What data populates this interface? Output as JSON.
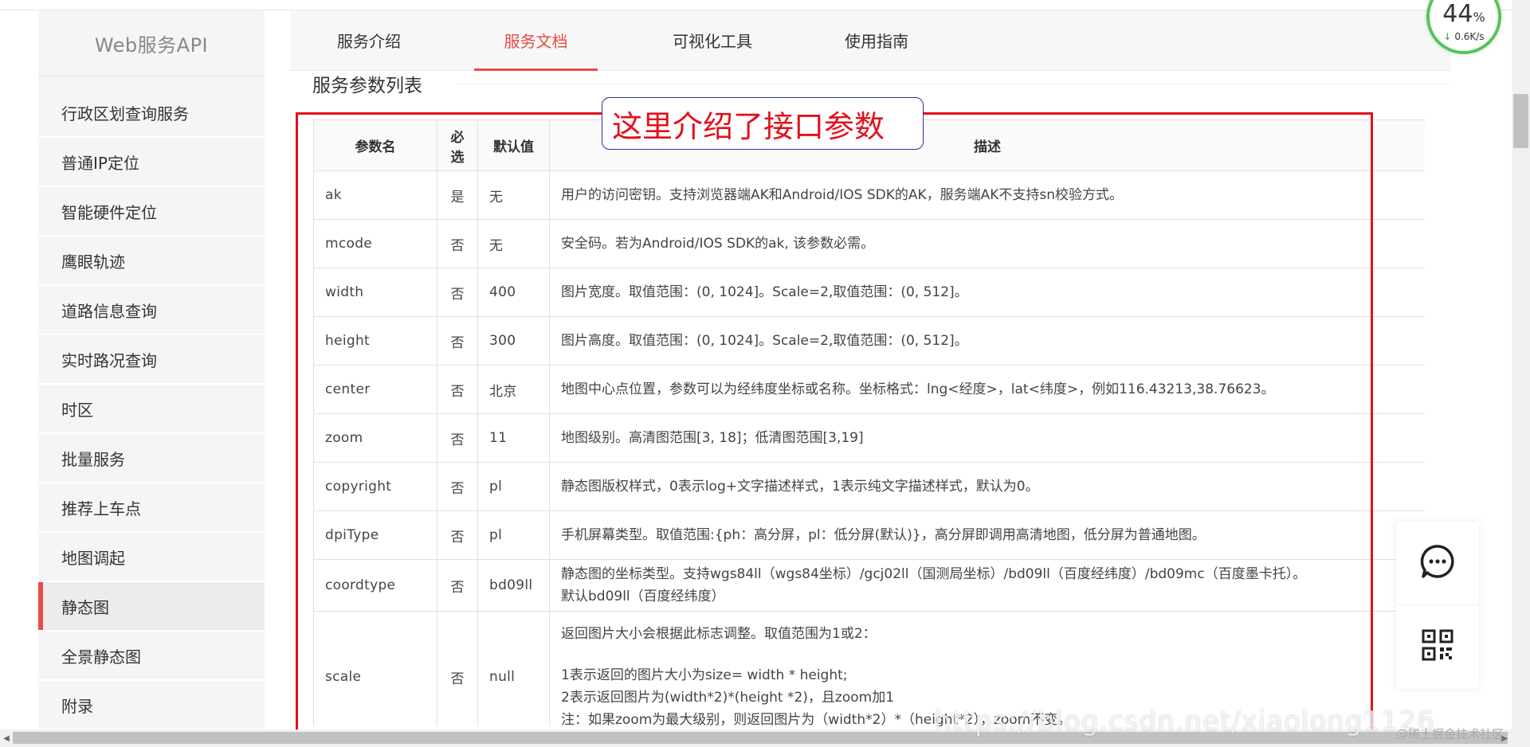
{
  "sidebar": {
    "brand": "Web服务API",
    "items": [
      {
        "label": "行政区划查询服务"
      },
      {
        "label": "普通IP定位"
      },
      {
        "label": "智能硬件定位"
      },
      {
        "label": "鹰眼轨迹"
      },
      {
        "label": "道路信息查询"
      },
      {
        "label": "实时路况查询"
      },
      {
        "label": "时区"
      },
      {
        "label": "批量服务"
      },
      {
        "label": "推荐上车点"
      },
      {
        "label": "地图调起"
      },
      {
        "label": "静态图",
        "active": true
      },
      {
        "label": "全景静态图"
      },
      {
        "label": "附录"
      }
    ]
  },
  "tabs": [
    {
      "label": "服务介绍"
    },
    {
      "label": "服务文档",
      "active": true
    },
    {
      "label": "可视化工具"
    },
    {
      "label": "使用指南"
    }
  ],
  "section_title": "服务参数列表",
  "annotation": "这里介绍了接口参数",
  "table": {
    "headers": {
      "name": "参数名",
      "required": "必选",
      "default": "默认值",
      "desc": "描述"
    },
    "rows": [
      {
        "name": "ak",
        "required": "是",
        "default": "无",
        "desc": [
          "用户的访问密钥。支持浏览器端AK和Android/IOS SDK的AK，服务端AK不支持sn校验方式。"
        ]
      },
      {
        "name": "mcode",
        "required": "否",
        "default": "无",
        "desc": [
          "安全码。若为Android/IOS SDK的ak, 该参数必需。"
        ]
      },
      {
        "name": "width",
        "required": "否",
        "default": "400",
        "desc": [
          "图片宽度。取值范围：(0, 1024]。Scale=2,取值范围：(0, 512]。"
        ]
      },
      {
        "name": "height",
        "required": "否",
        "default": "300",
        "desc": [
          "图片高度。取值范围：(0, 1024]。Scale=2,取值范围：(0, 512]。"
        ]
      },
      {
        "name": "center",
        "required": "否",
        "default": "北京",
        "desc": [
          "地图中心点位置，参数可以为经纬度坐标或名称。坐标格式：lng<经度>，lat<纬度>，例如116.43213,38.76623。"
        ]
      },
      {
        "name": "zoom",
        "required": "否",
        "default": "11",
        "desc": [
          "地图级别。高清图范围[3, 18]；低清图范围[3,19]"
        ]
      },
      {
        "name": "copyright",
        "required": "否",
        "default": "pl",
        "desc": [
          "静态图版权样式，0表示log+文字描述样式，1表示纯文字描述样式，默认为0。"
        ]
      },
      {
        "name": "dpiType",
        "required": "否",
        "default": "pl",
        "desc": [
          "手机屏幕类型。取值范围:{ph：高分屏，pl：低分屏(默认)}，高分屏即调用高清地图，低分屏为普通地图。"
        ]
      },
      {
        "name": "coordtype",
        "required": "否",
        "default": "bd09ll",
        "desc": [
          "静态图的坐标类型。支持wgs84ll（wgs84坐标）/gcj02ll（国测局坐标）/bd09ll（百度经纬度）/bd09mc（百度墨卡托）。",
          "默认bd09ll（百度经纬度）"
        ]
      },
      {
        "name": "scale",
        "required": "否",
        "default": "null",
        "desc": [
          "返回图片大小会根据此标志调整。取值范围为1或2：",
          "",
          "1表示返回的图片大小为size= width * height;",
          "2表示返回图片为(width*2)*(height *2)，且zoom加1",
          "注：如果zoom为最大级别，则返回图片为（width*2）*（height*2），zoom不变。"
        ]
      }
    ]
  },
  "speed_widget": {
    "percent": "44",
    "percent_unit": "%",
    "rate": "0.6K/s"
  },
  "watermark": "https://blog.csdn.net/xiaolong1126",
  "credit": "@稀土掘金技术社区",
  "colors": {
    "accent": "#e54d42",
    "annotation_red": "#e3101c",
    "annotation_border": "#2e3192",
    "speed_green": "#54c55a"
  }
}
